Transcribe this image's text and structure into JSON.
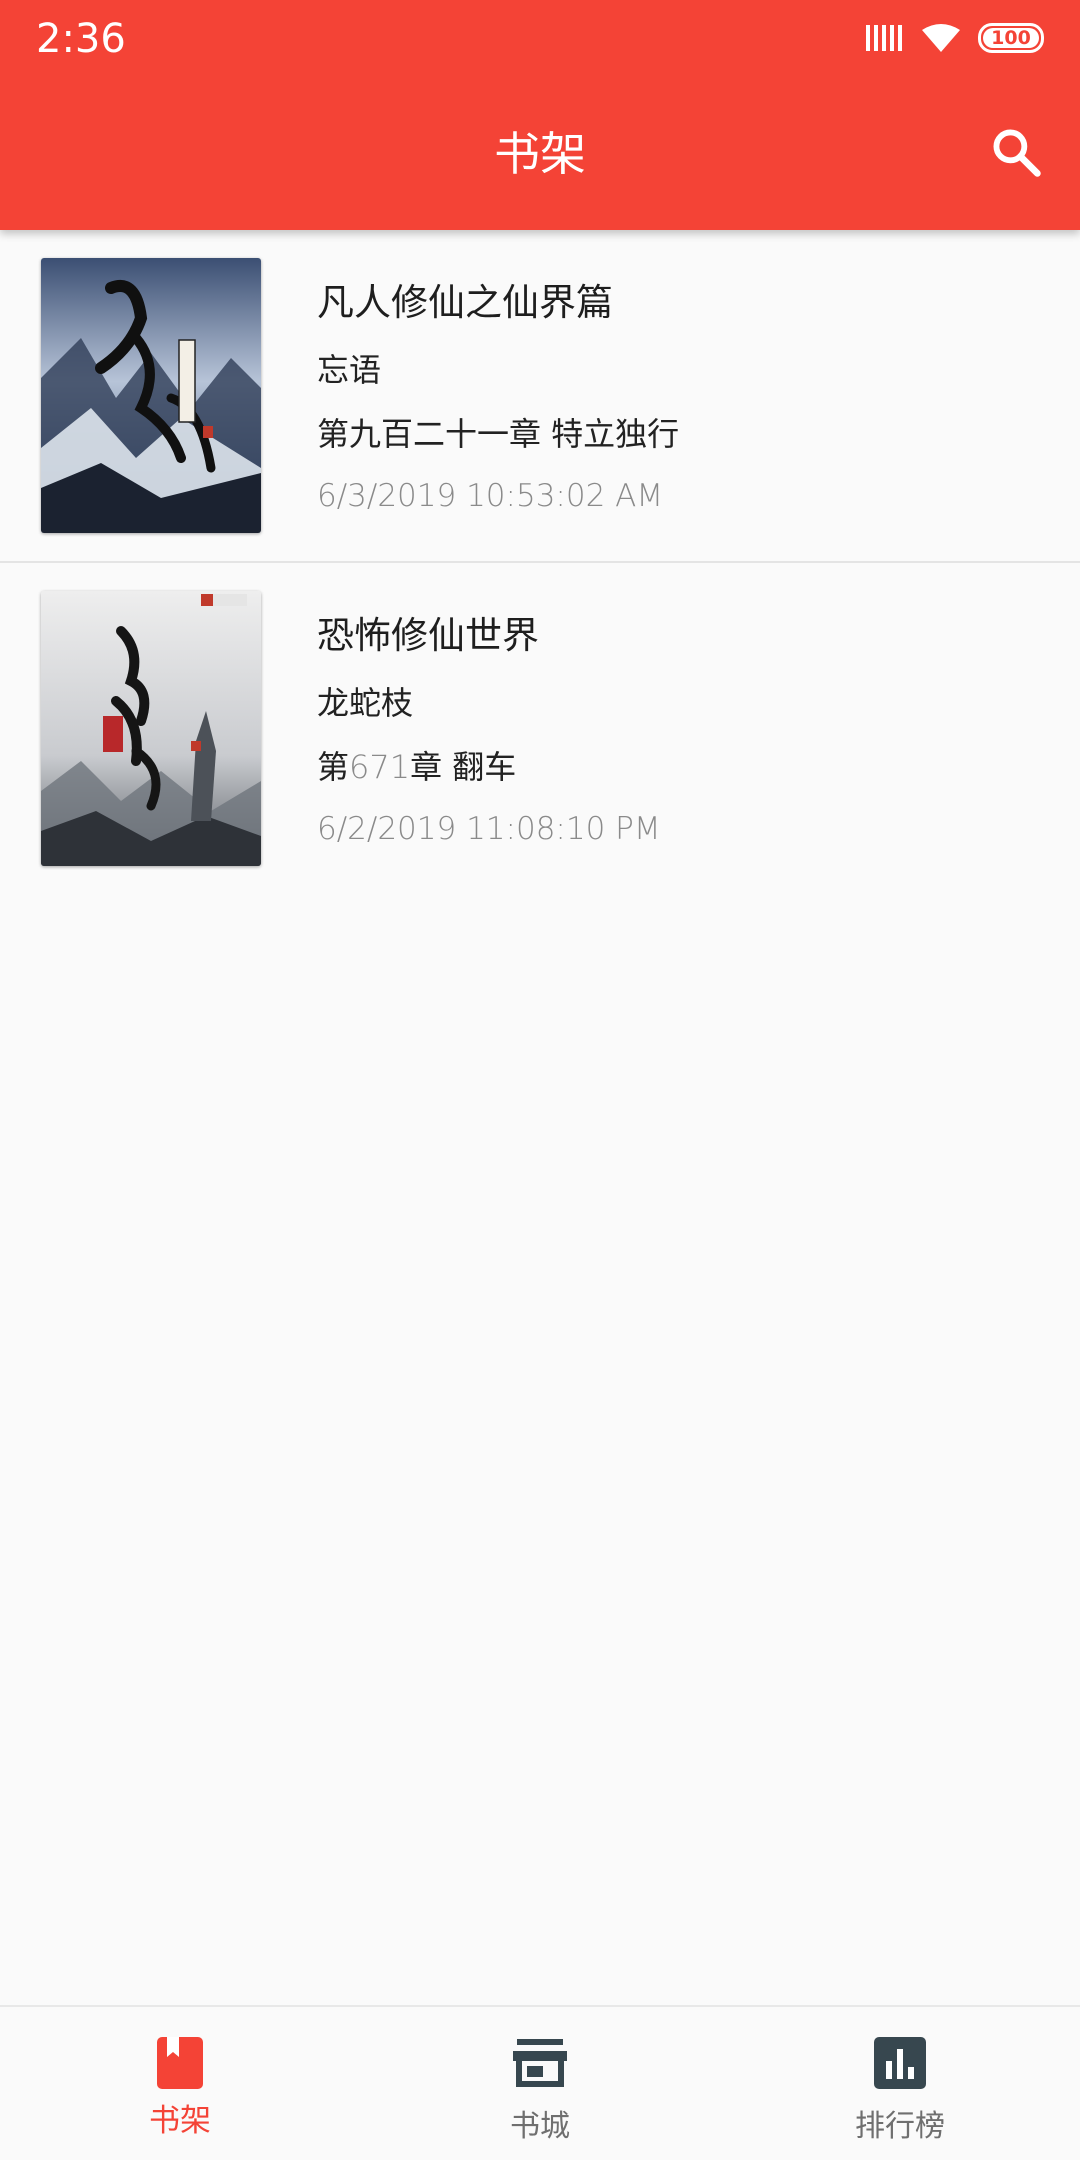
{
  "status_bar": {
    "time": "2:36",
    "battery": "100",
    "icons": [
      "signal-icon",
      "wifi-icon",
      "battery-icon"
    ]
  },
  "app_bar": {
    "title": "书架",
    "action_icon": "search-icon"
  },
  "books": [
    {
      "title": "凡人修仙之仙界篇",
      "author": "忘语",
      "last_chapter": "第九百二十一章 特立独行",
      "updated": "6/3/2019 10:53:02 AM"
    },
    {
      "title": "恐怖修仙世界",
      "author": "龙蛇枝",
      "last_chapter_prefix": "第",
      "last_chapter_number": "671",
      "last_chapter_suffix": "章 翻车",
      "updated": "6/2/2019 11:08:10 PM"
    }
  ],
  "bottom_nav": {
    "items": [
      {
        "label": "书架",
        "icon": "bookshelf-icon",
        "active": true
      },
      {
        "label": "书城",
        "icon": "store-icon",
        "active": false
      },
      {
        "label": "排行榜",
        "icon": "ranking-chart-icon",
        "active": false
      }
    ]
  },
  "colors": {
    "primary": "#f44336",
    "background": "#fafafa",
    "nav_inactive": "#6f6f6f",
    "icon_dark": "#37474f",
    "secondary_text": "#8a8a8a"
  }
}
